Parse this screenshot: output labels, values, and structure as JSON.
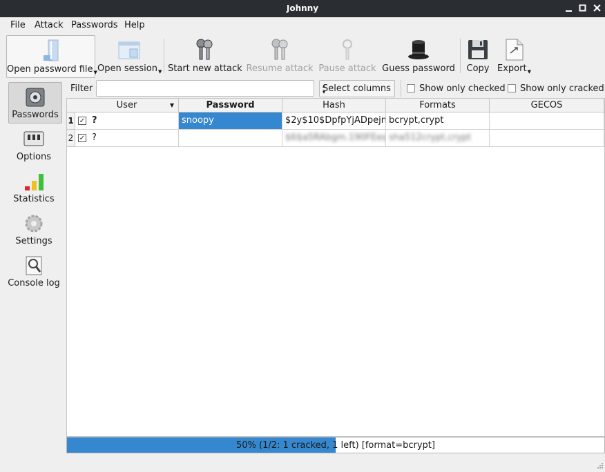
{
  "window": {
    "title": "Johnny"
  },
  "menu": [
    "File",
    "Attack",
    "Passwords",
    "Help"
  ],
  "toolbar": {
    "open_password_file": "Open password file",
    "open_session": "Open session",
    "start_new_attack": "Start new attack",
    "resume_attack": "Resume attack",
    "pause_attack": "Pause attack",
    "guess_password": "Guess password",
    "copy": "Copy",
    "export": "Export"
  },
  "sidebar": [
    "Passwords",
    "Options",
    "Statistics",
    "Settings",
    "Console log"
  ],
  "filter": {
    "label": "Filter",
    "value": "",
    "select_columns": "Select columns",
    "show_only_checked": "Show only checked",
    "show_only_cracked": "Show only cracked"
  },
  "table": {
    "columns": [
      "User",
      "Password",
      "Hash",
      "Formats",
      "GECOS"
    ],
    "rows": [
      {
        "num": "1",
        "checked": "✓",
        "user": "?",
        "password": "snoopy",
        "hash": "$2y$10$DpfpYjADpejn",
        "formats": "bcrypt,crypt",
        "gecos": ""
      },
      {
        "num": "2",
        "checked": "✓",
        "user": "?",
        "password": "",
        "hash": "$6$a5RAbgm.190FEeq",
        "formats": "sha512crypt,crypt",
        "gecos": ""
      }
    ]
  },
  "progress": {
    "value": 0.5,
    "text": "50% (1/2: 1 cracked, 1 left) [format=bcrypt]"
  },
  "colors": {
    "accent": "#3587cf",
    "titlebar": "#2a2e32"
  }
}
